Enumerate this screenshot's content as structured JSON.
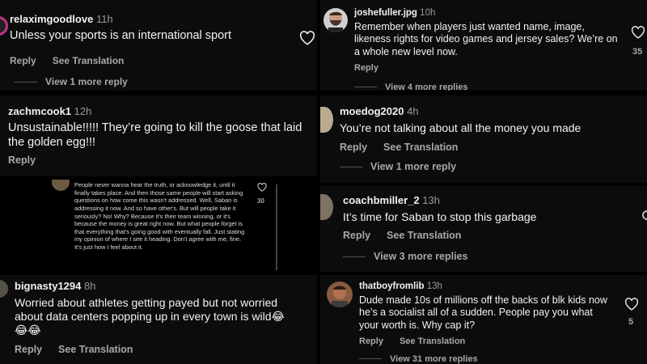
{
  "c1": {
    "user": "relaximgoodlove",
    "time": "11h",
    "text": "Unless your sports is an international sport",
    "reply": "Reply",
    "translate": "See Translation",
    "more": "View 1 more reply"
  },
  "c2": {
    "user": "joshefuller.jpg",
    "time": "10h",
    "text": "Remember when players just wanted name, image, likeness rights for video games and jersey sales? We’re on a whole new level now.",
    "reply": "Reply",
    "more": "View 4 more replies",
    "likes": "35"
  },
  "c3": {
    "user": "zachmcook1",
    "time": "12h",
    "text": "Unsustainable!!!!! They’re going to kill the goose that laid the golden egg!!!",
    "reply": "Reply"
  },
  "c4": {
    "user": "moedog2020",
    "time": "4h",
    "text": "You’re not talking about all the money you made",
    "reply": "Reply",
    "translate": "See Translation",
    "more": "View 1 more reply"
  },
  "c5": {
    "text": "People never wanna hear the truth, or acknowledge it, until it finally takes place. And then those same people will start asking questions on how come this wasn't addressed. Well, Saban is addressing it now. And so have other's. But will people take it seriously? No! Why? Because it's their team winning, or it's because the money is great right now. But what people forget is that everything that's going good with eventually fall. Just stating my opinion of where I see it heading. Don't agree with me, fine. It's just how I feel about it.",
    "likes": "30"
  },
  "c6": {
    "user": "coachbmiller_2",
    "time": "13h",
    "text": "It’s time for Saban to stop this garbage",
    "reply": "Reply",
    "translate": "See Translation",
    "more": "View 3 more replies"
  },
  "c7": {
    "user": "bignasty1294",
    "time": "8h",
    "text": "Worried about athletes getting payed but not worried about data centers popping up in every town is wild😂😂😂",
    "reply": "Reply",
    "translate": "See Translation"
  },
  "c8": {
    "user": "thatboyfromlib",
    "time": "13h",
    "text": "Dude made 10s of millions off the backs of blk kids now he’s a socialist all of a sudden. People pay you what your worth is. Why cap it?",
    "reply": "Reply",
    "translate": "See Translation",
    "more": "View 31 more replies",
    "likes": "5"
  },
  "colors": {
    "bg": "#000000",
    "text": "#f5f5f5",
    "muted": "#a8a8a8"
  }
}
